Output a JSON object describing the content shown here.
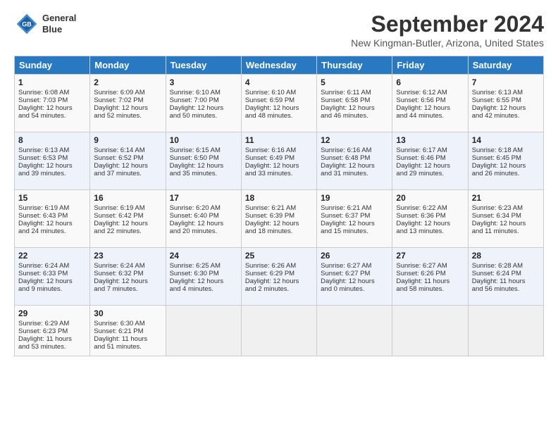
{
  "header": {
    "logo_line1": "General",
    "logo_line2": "Blue",
    "title": "September 2024",
    "location": "New Kingman-Butler, Arizona, United States"
  },
  "weekdays": [
    "Sunday",
    "Monday",
    "Tuesday",
    "Wednesday",
    "Thursday",
    "Friday",
    "Saturday"
  ],
  "weeks": [
    [
      {
        "day": "1",
        "lines": [
          "Sunrise: 6:08 AM",
          "Sunset: 7:03 PM",
          "Daylight: 12 hours",
          "and 54 minutes."
        ]
      },
      {
        "day": "2",
        "lines": [
          "Sunrise: 6:09 AM",
          "Sunset: 7:02 PM",
          "Daylight: 12 hours",
          "and 52 minutes."
        ]
      },
      {
        "day": "3",
        "lines": [
          "Sunrise: 6:10 AM",
          "Sunset: 7:00 PM",
          "Daylight: 12 hours",
          "and 50 minutes."
        ]
      },
      {
        "day": "4",
        "lines": [
          "Sunrise: 6:10 AM",
          "Sunset: 6:59 PM",
          "Daylight: 12 hours",
          "and 48 minutes."
        ]
      },
      {
        "day": "5",
        "lines": [
          "Sunrise: 6:11 AM",
          "Sunset: 6:58 PM",
          "Daylight: 12 hours",
          "and 46 minutes."
        ]
      },
      {
        "day": "6",
        "lines": [
          "Sunrise: 6:12 AM",
          "Sunset: 6:56 PM",
          "Daylight: 12 hours",
          "and 44 minutes."
        ]
      },
      {
        "day": "7",
        "lines": [
          "Sunrise: 6:13 AM",
          "Sunset: 6:55 PM",
          "Daylight: 12 hours",
          "and 42 minutes."
        ]
      }
    ],
    [
      {
        "day": "8",
        "lines": [
          "Sunrise: 6:13 AM",
          "Sunset: 6:53 PM",
          "Daylight: 12 hours",
          "and 39 minutes."
        ]
      },
      {
        "day": "9",
        "lines": [
          "Sunrise: 6:14 AM",
          "Sunset: 6:52 PM",
          "Daylight: 12 hours",
          "and 37 minutes."
        ]
      },
      {
        "day": "10",
        "lines": [
          "Sunrise: 6:15 AM",
          "Sunset: 6:50 PM",
          "Daylight: 12 hours",
          "and 35 minutes."
        ]
      },
      {
        "day": "11",
        "lines": [
          "Sunrise: 6:16 AM",
          "Sunset: 6:49 PM",
          "Daylight: 12 hours",
          "and 33 minutes."
        ]
      },
      {
        "day": "12",
        "lines": [
          "Sunrise: 6:16 AM",
          "Sunset: 6:48 PM",
          "Daylight: 12 hours",
          "and 31 minutes."
        ]
      },
      {
        "day": "13",
        "lines": [
          "Sunrise: 6:17 AM",
          "Sunset: 6:46 PM",
          "Daylight: 12 hours",
          "and 29 minutes."
        ]
      },
      {
        "day": "14",
        "lines": [
          "Sunrise: 6:18 AM",
          "Sunset: 6:45 PM",
          "Daylight: 12 hours",
          "and 26 minutes."
        ]
      }
    ],
    [
      {
        "day": "15",
        "lines": [
          "Sunrise: 6:19 AM",
          "Sunset: 6:43 PM",
          "Daylight: 12 hours",
          "and 24 minutes."
        ]
      },
      {
        "day": "16",
        "lines": [
          "Sunrise: 6:19 AM",
          "Sunset: 6:42 PM",
          "Daylight: 12 hours",
          "and 22 minutes."
        ]
      },
      {
        "day": "17",
        "lines": [
          "Sunrise: 6:20 AM",
          "Sunset: 6:40 PM",
          "Daylight: 12 hours",
          "and 20 minutes."
        ]
      },
      {
        "day": "18",
        "lines": [
          "Sunrise: 6:21 AM",
          "Sunset: 6:39 PM",
          "Daylight: 12 hours",
          "and 18 minutes."
        ]
      },
      {
        "day": "19",
        "lines": [
          "Sunrise: 6:21 AM",
          "Sunset: 6:37 PM",
          "Daylight: 12 hours",
          "and 15 minutes."
        ]
      },
      {
        "day": "20",
        "lines": [
          "Sunrise: 6:22 AM",
          "Sunset: 6:36 PM",
          "Daylight: 12 hours",
          "and 13 minutes."
        ]
      },
      {
        "day": "21",
        "lines": [
          "Sunrise: 6:23 AM",
          "Sunset: 6:34 PM",
          "Daylight: 12 hours",
          "and 11 minutes."
        ]
      }
    ],
    [
      {
        "day": "22",
        "lines": [
          "Sunrise: 6:24 AM",
          "Sunset: 6:33 PM",
          "Daylight: 12 hours",
          "and 9 minutes."
        ]
      },
      {
        "day": "23",
        "lines": [
          "Sunrise: 6:24 AM",
          "Sunset: 6:32 PM",
          "Daylight: 12 hours",
          "and 7 minutes."
        ]
      },
      {
        "day": "24",
        "lines": [
          "Sunrise: 6:25 AM",
          "Sunset: 6:30 PM",
          "Daylight: 12 hours",
          "and 4 minutes."
        ]
      },
      {
        "day": "25",
        "lines": [
          "Sunrise: 6:26 AM",
          "Sunset: 6:29 PM",
          "Daylight: 12 hours",
          "and 2 minutes."
        ]
      },
      {
        "day": "26",
        "lines": [
          "Sunrise: 6:27 AM",
          "Sunset: 6:27 PM",
          "Daylight: 12 hours",
          "and 0 minutes."
        ]
      },
      {
        "day": "27",
        "lines": [
          "Sunrise: 6:27 AM",
          "Sunset: 6:26 PM",
          "Daylight: 11 hours",
          "and 58 minutes."
        ]
      },
      {
        "day": "28",
        "lines": [
          "Sunrise: 6:28 AM",
          "Sunset: 6:24 PM",
          "Daylight: 11 hours",
          "and 56 minutes."
        ]
      }
    ],
    [
      {
        "day": "29",
        "lines": [
          "Sunrise: 6:29 AM",
          "Sunset: 6:23 PM",
          "Daylight: 11 hours",
          "and 53 minutes."
        ]
      },
      {
        "day": "30",
        "lines": [
          "Sunrise: 6:30 AM",
          "Sunset: 6:21 PM",
          "Daylight: 11 hours",
          "and 51 minutes."
        ]
      },
      null,
      null,
      null,
      null,
      null
    ]
  ]
}
